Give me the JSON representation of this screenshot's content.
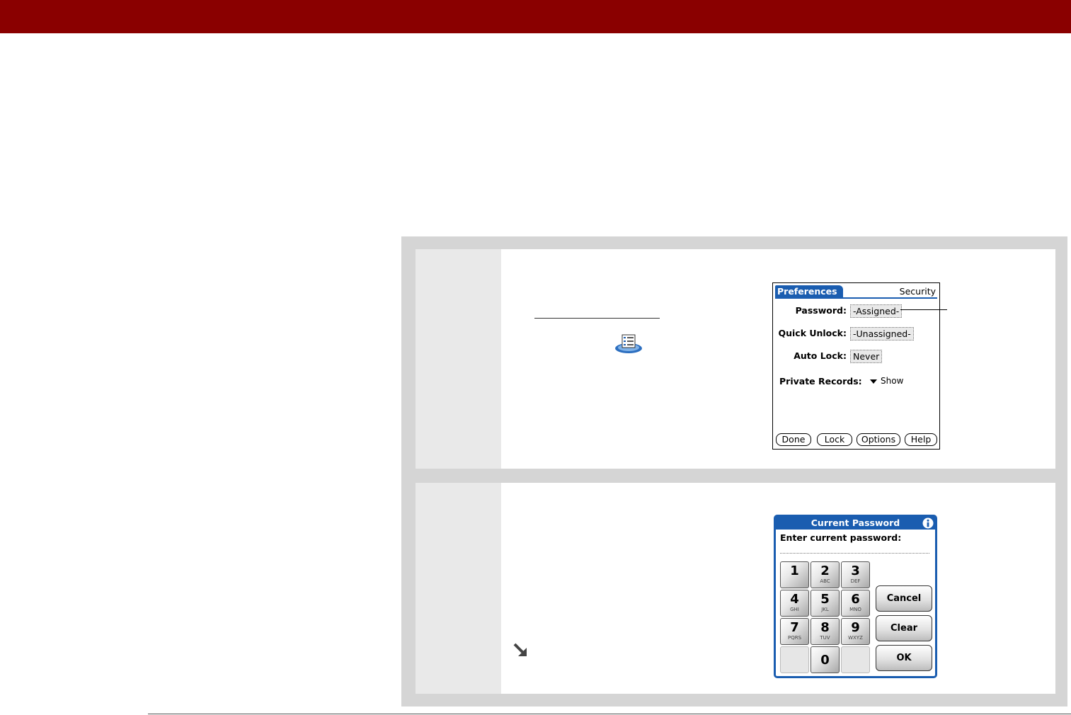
{
  "colors": {
    "header_band": "#8a0000",
    "step_box": "#d5d5d5",
    "palm_blue": "#1a5db0"
  },
  "security_screen": {
    "title": "Preferences",
    "panel": "Security",
    "password": {
      "label": "Password:",
      "value": "-Assigned-"
    },
    "quick_unlock": {
      "label": "Quick Unlock:",
      "value": "-Unassigned-"
    },
    "auto_lock": {
      "label": "Auto Lock:",
      "value": "Never"
    },
    "private_records": {
      "label": "Private Records:",
      "value": "Show"
    },
    "buttons": [
      "Done",
      "Lock",
      "Options",
      "Help"
    ]
  },
  "password_dialog": {
    "title": "Current Password",
    "prompt": "Enter current password:",
    "keys": [
      {
        "digit": "1",
        "letters": ""
      },
      {
        "digit": "2",
        "letters": "ABC"
      },
      {
        "digit": "3",
        "letters": "DEF"
      },
      {
        "digit": "4",
        "letters": "GHI"
      },
      {
        "digit": "5",
        "letters": "JKL"
      },
      {
        "digit": "6",
        "letters": "MNO"
      },
      {
        "digit": "7",
        "letters": "PQRS"
      },
      {
        "digit": "8",
        "letters": "TUV"
      },
      {
        "digit": "9",
        "letters": "WXYZ"
      },
      {
        "digit": "0",
        "letters": ""
      }
    ],
    "buttons": {
      "cancel": "Cancel",
      "clear": "Clear",
      "ok": "OK"
    }
  },
  "icons": [
    "preferences-app-icon",
    "info-icon",
    "arrow-icon"
  ]
}
